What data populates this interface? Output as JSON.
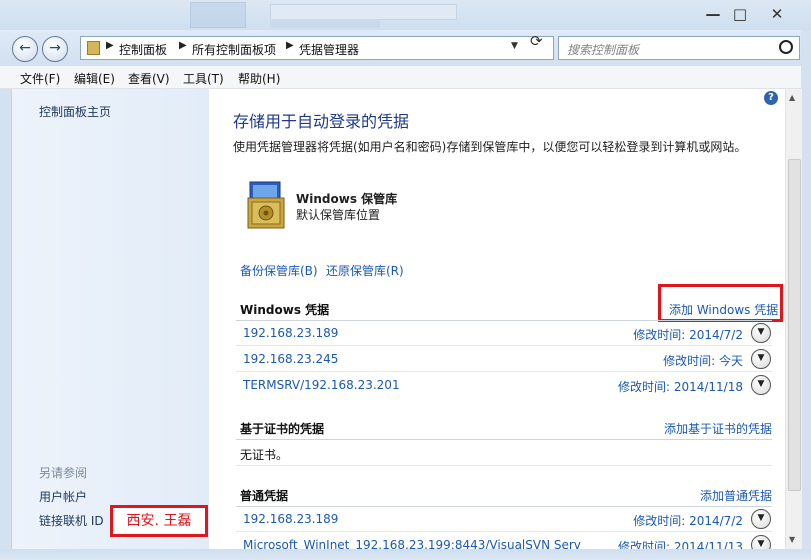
{
  "window": {
    "minimize": "—",
    "maximize": "□",
    "close": "✕"
  },
  "nav": {
    "back": "←",
    "forward": "→"
  },
  "address": {
    "crumbs": [
      "控制面板",
      "所有控制面板项",
      "凭据管理器"
    ],
    "search_placeholder": "搜索控制面板"
  },
  "menu": [
    "文件(F)",
    "编辑(E)",
    "查看(V)",
    "工具(T)",
    "帮助(H)"
  ],
  "sidebar": {
    "home": "控制面板主页",
    "see_also": "另请参阅",
    "links": [
      "用户帐户",
      "链接联机 ID"
    ]
  },
  "main": {
    "title": "存储用于自动登录的凭据",
    "description": "使用凭据管理器将凭据(如用户名和密码)存储到保管库中，以便您可以轻松登录到计算机或网站。",
    "vault": {
      "title": "Windows 保管库",
      "subtitle": "默认保管库位置"
    },
    "backup": "备份保管库(B)",
    "restore": "还原保管库(R)",
    "windows_creds": {
      "title": "Windows 凭据",
      "add": "添加 Windows 凭据",
      "items": [
        {
          "name": "192.168.23.189",
          "date": "修改时间: 2014/7/2"
        },
        {
          "name": "192.168.23.245",
          "date": "修改时间: 今天"
        },
        {
          "name": "TERMSRV/192.168.23.201",
          "date": "修改时间: 2014/11/18"
        }
      ]
    },
    "cert_creds": {
      "title": "基于证书的凭据",
      "add": "添加基于证书的凭据",
      "empty": "无证书。"
    },
    "generic_creds": {
      "title": "普通凭据",
      "add": "添加普通凭据",
      "items": [
        {
          "name": "192.168.23.189",
          "date": "修改时间: 2014/7/2"
        },
        {
          "name": "Microsoft_WinInet_192.168.23.199:8443/VisualSVN Serv",
          "date": "修改时间: 2014/11/13"
        }
      ]
    }
  },
  "watermark": "西安. 王磊",
  "colors": {
    "accent_link": "#1a59b3",
    "highlight_box": "#e0161f",
    "title_blue": "#1e3a8a"
  },
  "icons": [
    "back-arrow-icon",
    "forward-arrow-icon",
    "folder-icon",
    "refresh-icon",
    "search-icon",
    "help-icon",
    "vault-icon",
    "chevron-down-icon"
  ]
}
